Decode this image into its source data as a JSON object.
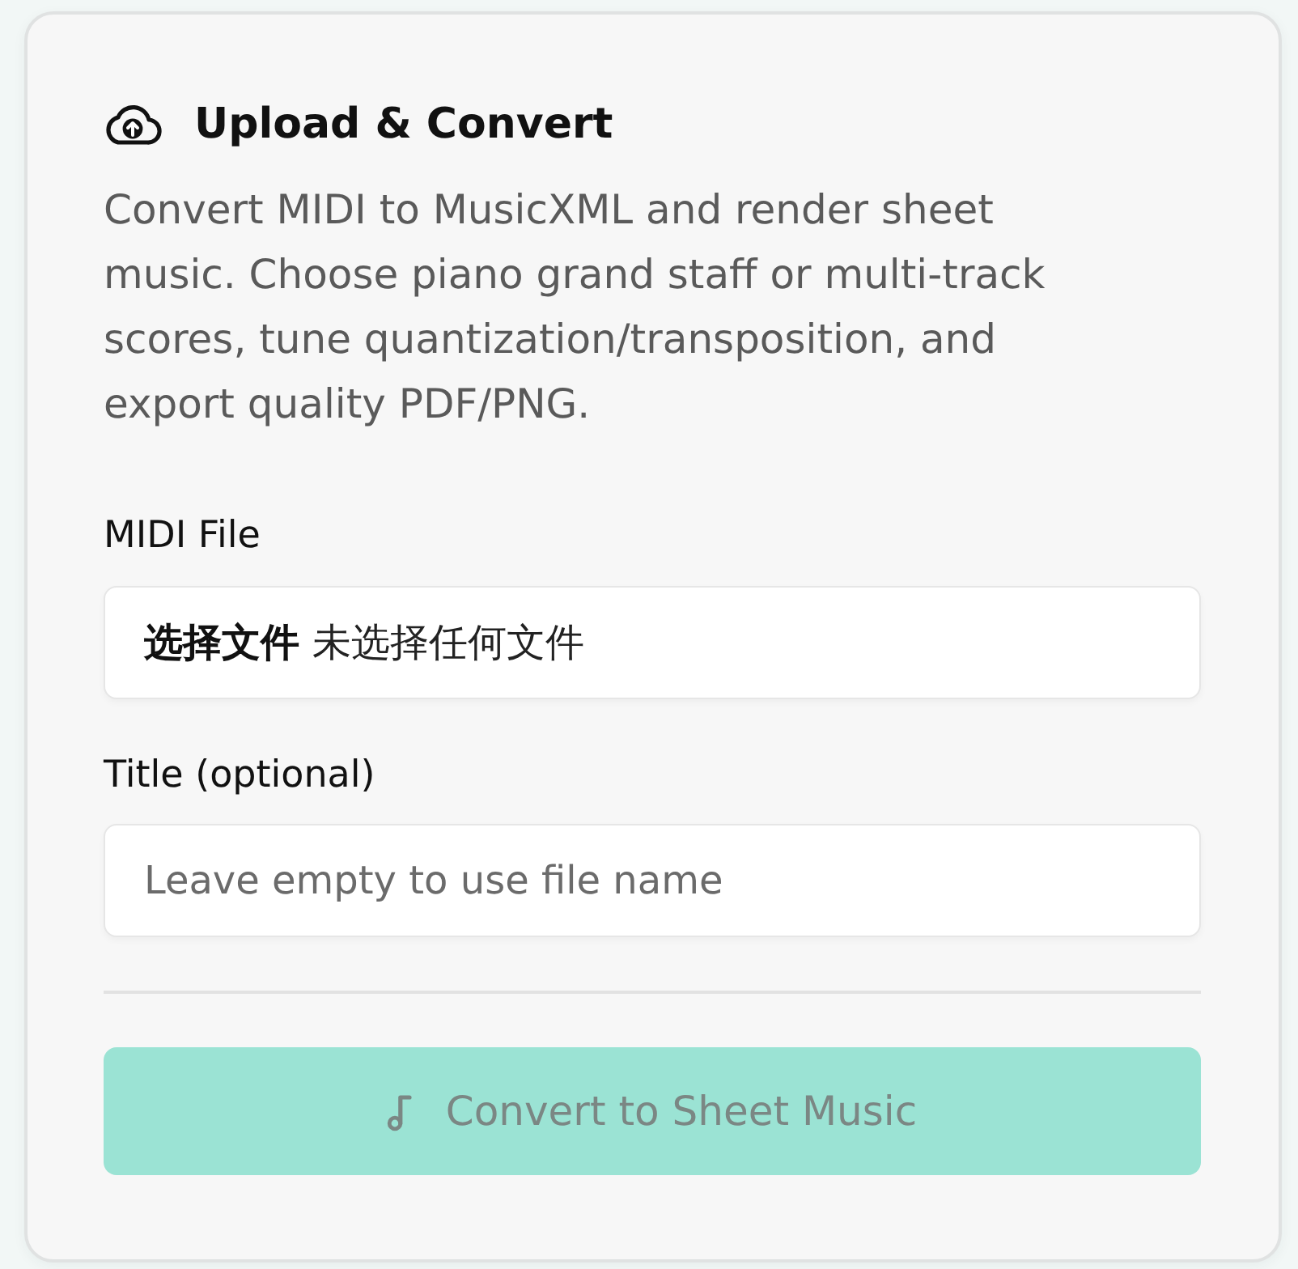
{
  "card": {
    "title": "Upload & Convert",
    "description": "Convert MIDI to MusicXML and render sheet music. Choose piano grand staff or multi-track scores, tune quantization/transposition, and export quality PDF/PNG.",
    "fields": [
      {
        "kind": "file",
        "label": "MIDI File",
        "button": "选择文件",
        "status": "未选择任何文件"
      },
      {
        "kind": "text",
        "label": "Title (optional)",
        "placeholder": "Leave empty to use file name"
      }
    ],
    "submit": {
      "label": "Convert to Sheet Music",
      "disabled": true
    }
  }
}
